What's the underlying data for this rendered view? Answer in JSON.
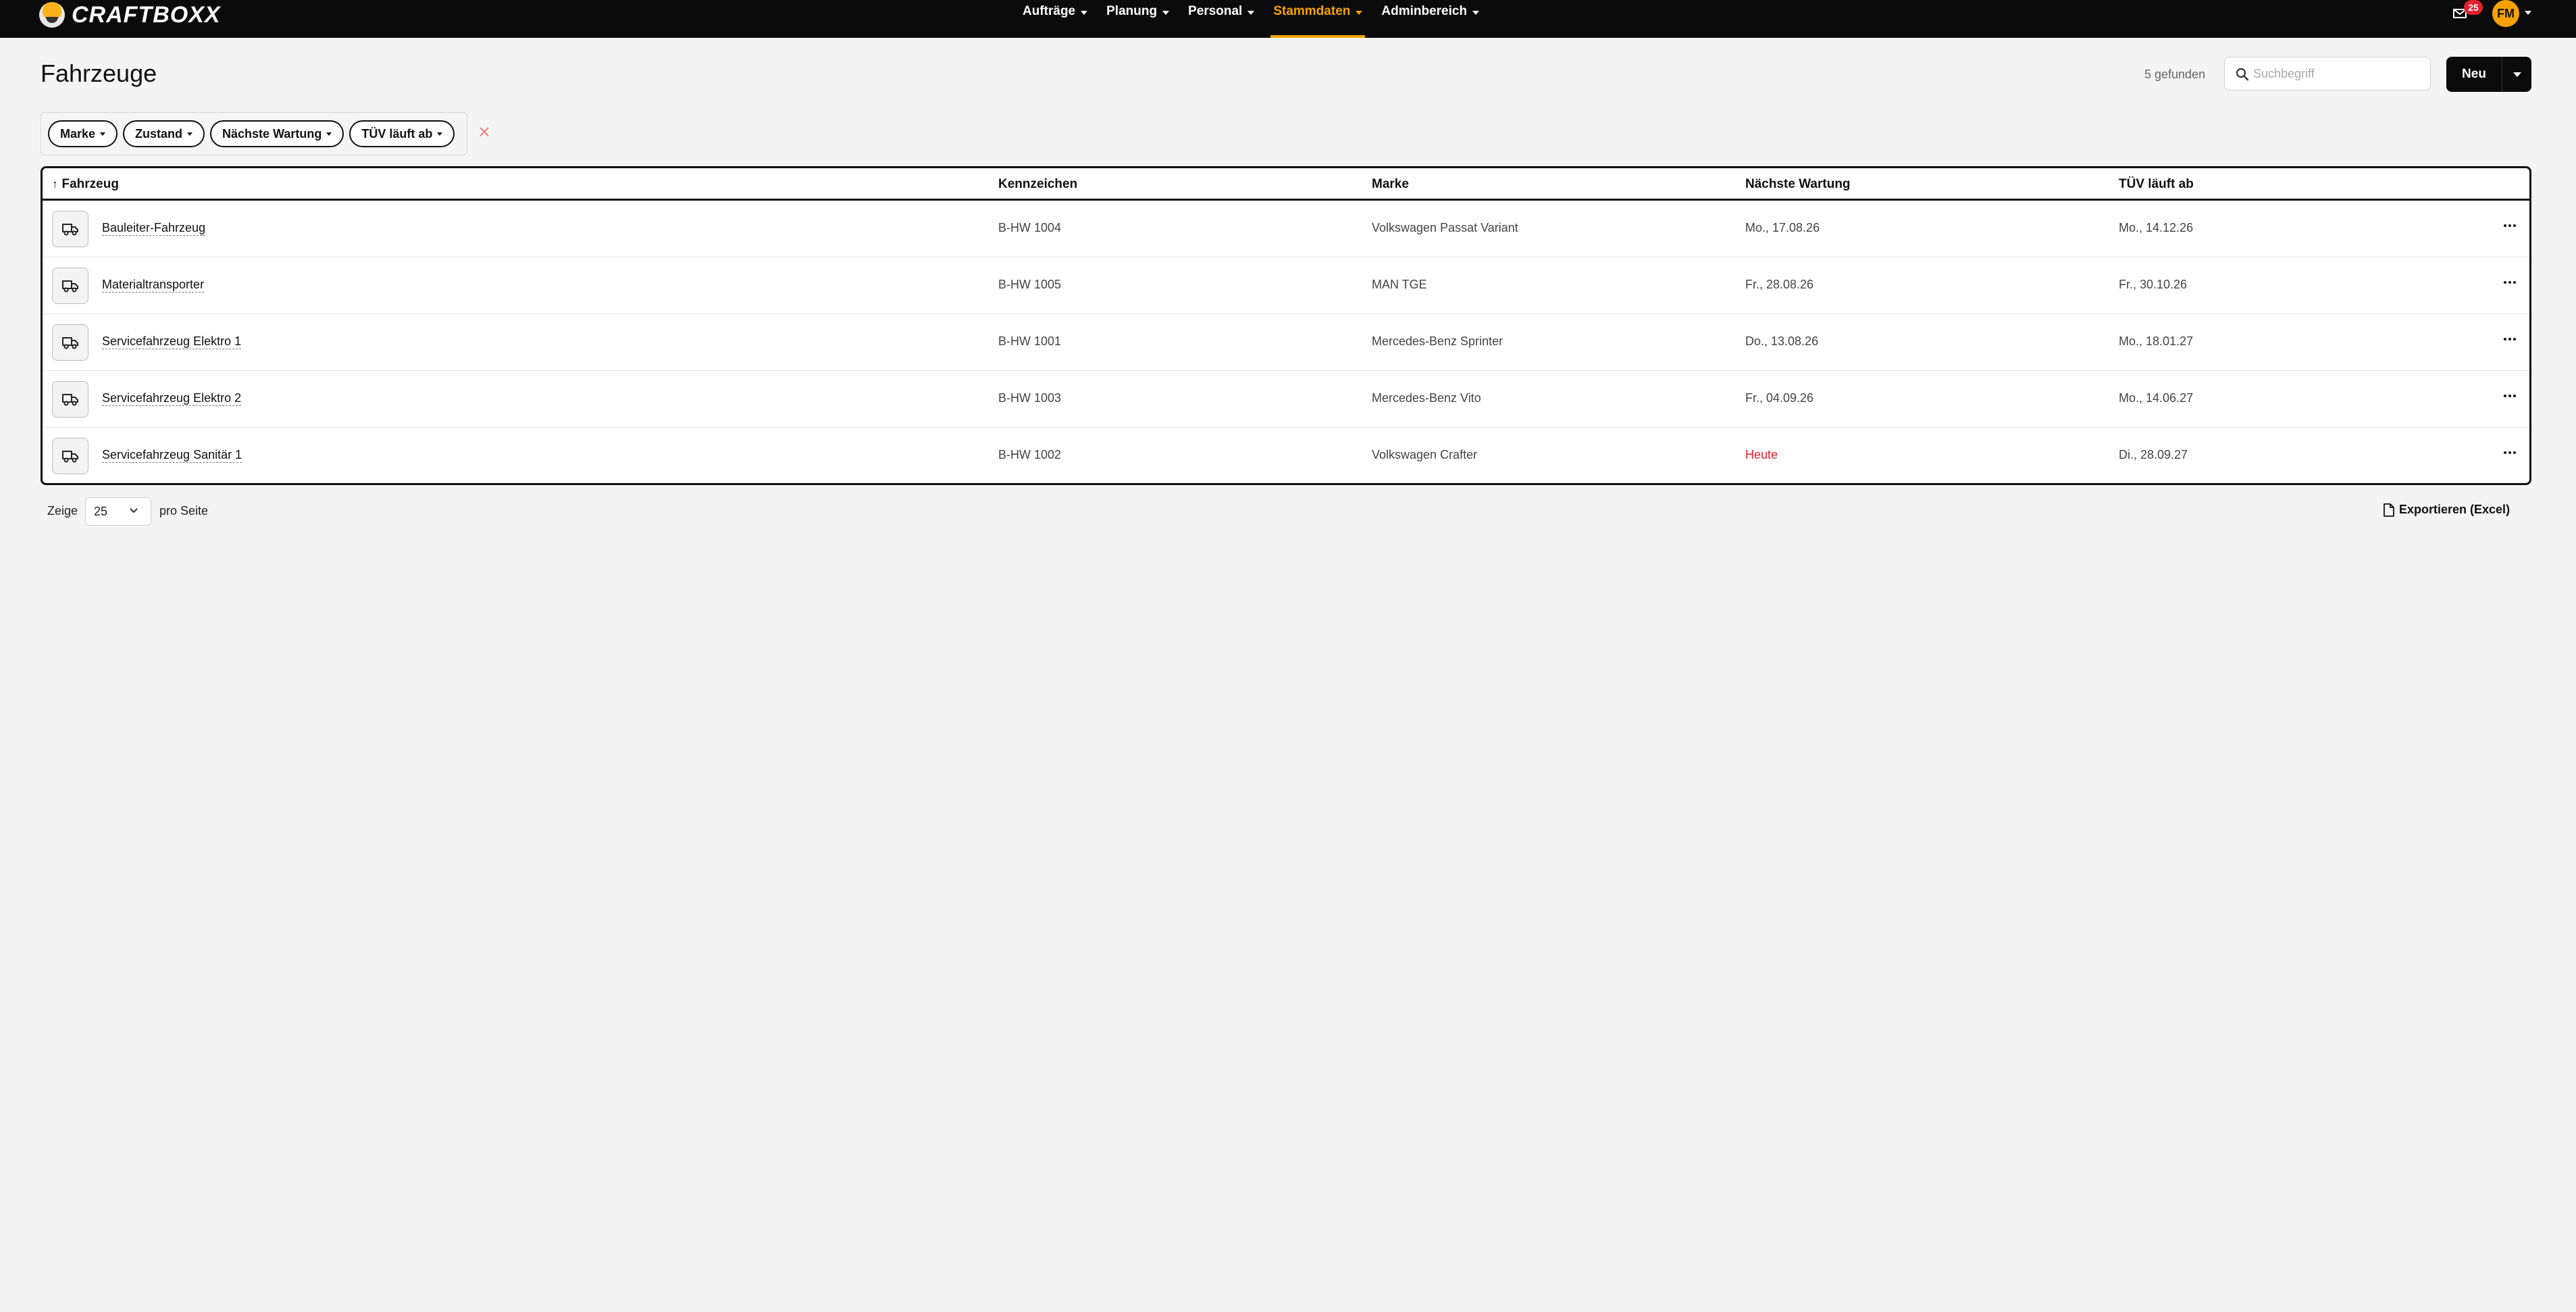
{
  "app": {
    "brand": "CRAFTBOXX",
    "nav": [
      {
        "label": "Aufträge",
        "active": false
      },
      {
        "label": "Planung",
        "active": false
      },
      {
        "label": "Personal",
        "active": false
      },
      {
        "label": "Stammdaten",
        "active": true
      },
      {
        "label": "Adminbereich",
        "active": false
      }
    ],
    "notification_count": "25",
    "user_initials": "FM",
    "colors": {
      "accent": "#f5a200",
      "danger": "#e0202e",
      "nav_bg": "#0b0b0b"
    }
  },
  "page": {
    "title": "Fahrzeuge",
    "result_count": "5 gefunden",
    "search_placeholder": "Suchbegriff",
    "new_button": "Neu"
  },
  "filters": [
    "Marke",
    "Zustand",
    "Nächste Wartung",
    "TÜV läuft ab"
  ],
  "table": {
    "columns": {
      "vehicle": "Fahrzeug",
      "plate": "Kennzeichen",
      "brand": "Marke",
      "next_service": "Nächste Wartung",
      "tuv": "TÜV läuft ab"
    },
    "sort_indicator": "↑",
    "rows": [
      {
        "name": "Bauleiter-Fahrzeug",
        "plate": "B-HW 1004",
        "brand": "Volkswagen Passat Variant",
        "next_service": "Mo., 17.08.26",
        "tuv": "Mo., 14.12.26",
        "service_due": false
      },
      {
        "name": "Materialtransporter",
        "plate": "B-HW 1005",
        "brand": "MAN TGE",
        "next_service": "Fr., 28.08.26",
        "tuv": "Fr., 30.10.26",
        "service_due": false
      },
      {
        "name": "Servicefahrzeug Elektro 1",
        "plate": "B-HW 1001",
        "brand": "Mercedes-Benz Sprinter",
        "next_service": "Do., 13.08.26",
        "tuv": "Mo., 18.01.27",
        "service_due": false
      },
      {
        "name": "Servicefahrzeug Elektro 2",
        "plate": "B-HW 1003",
        "brand": "Mercedes-Benz Vito",
        "next_service": "Fr., 04.09.26",
        "tuv": "Mo., 14.06.27",
        "service_due": false
      },
      {
        "name": "Servicefahrzeug Sanitär 1",
        "plate": "B-HW 1002",
        "brand": "Volkswagen Crafter",
        "next_service": "Heute",
        "tuv": "Di., 28.09.27",
        "service_due": true
      }
    ]
  },
  "footer": {
    "show_label": "Zeige",
    "per_page_value": "25",
    "per_page_label": "pro Seite",
    "export_label": "Exportieren (Excel)"
  }
}
